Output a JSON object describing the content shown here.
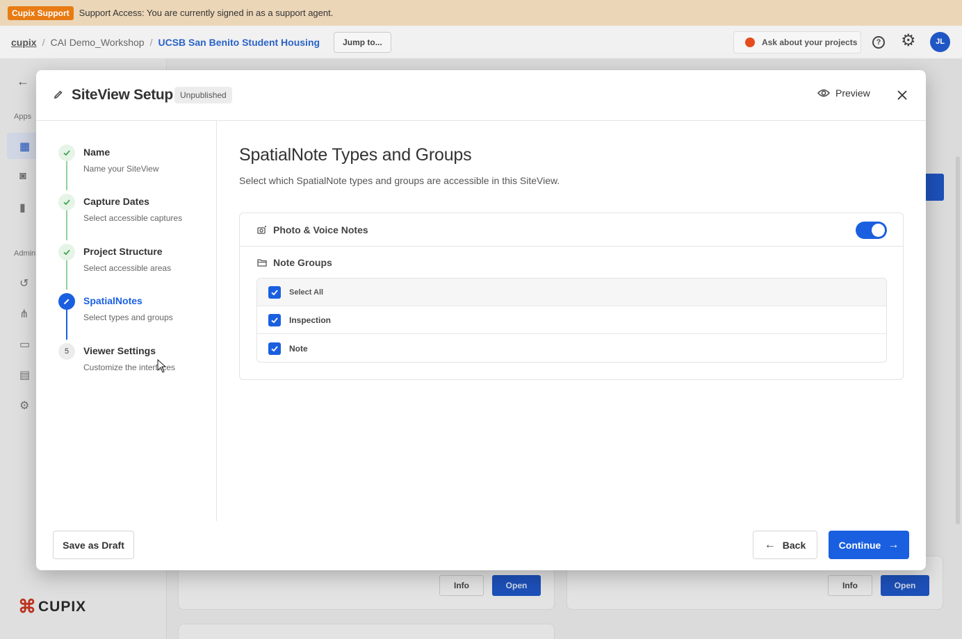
{
  "support_bar": {
    "badge": "Cupix Support",
    "message": "Support Access: You are currently signed in as a support agent."
  },
  "header": {
    "breadcrumb": [
      "cupix",
      "CAI Demo_Workshop",
      "UCSB San Benito Student Housing"
    ],
    "separator": "/",
    "jump_label": "Jump to...",
    "ask_label": "Ask about your projects",
    "avatar_initials": "JL"
  },
  "sidebar": {
    "section_apps": "Apps",
    "section_admin": "Admin",
    "logo_text": "CUPIX"
  },
  "background": {
    "info_label": "Info",
    "open_label": "Open"
  },
  "modal": {
    "title": "SiteView Setup",
    "status": "Unpublished",
    "preview_label": "Preview",
    "steps": [
      {
        "number": "1",
        "title": "Name",
        "subtitle": "Name your SiteView",
        "state": "done"
      },
      {
        "number": "2",
        "title": "Capture Dates",
        "subtitle": "Select accessible captures",
        "state": "done"
      },
      {
        "number": "3",
        "title": "Project Structure",
        "subtitle": "Select accessible areas",
        "state": "done"
      },
      {
        "number": "4",
        "title": "SpatialNotes",
        "subtitle": "Select types and groups",
        "state": "active"
      },
      {
        "number": "5",
        "title": "Viewer Settings",
        "subtitle": "Customize the interfaces",
        "state": "pending"
      }
    ],
    "content": {
      "title": "SpatialNote Types and Groups",
      "description": "Select which SpatialNote types and groups are accessible in this SiteView.",
      "photo_voice_label": "Photo & Voice Notes",
      "photo_voice_enabled": true,
      "note_groups_label": "Note Groups",
      "groups": [
        {
          "label": "Select All",
          "checked": true
        },
        {
          "label": "Inspection",
          "checked": true
        },
        {
          "label": "Note",
          "checked": true
        }
      ]
    },
    "footer": {
      "save_draft_label": "Save as Draft",
      "back_label": "Back",
      "continue_label": "Continue"
    }
  },
  "colors": {
    "accent": "#1a5fe0",
    "support_badge": "#e87b13",
    "step_done": "#e5f4e6"
  }
}
